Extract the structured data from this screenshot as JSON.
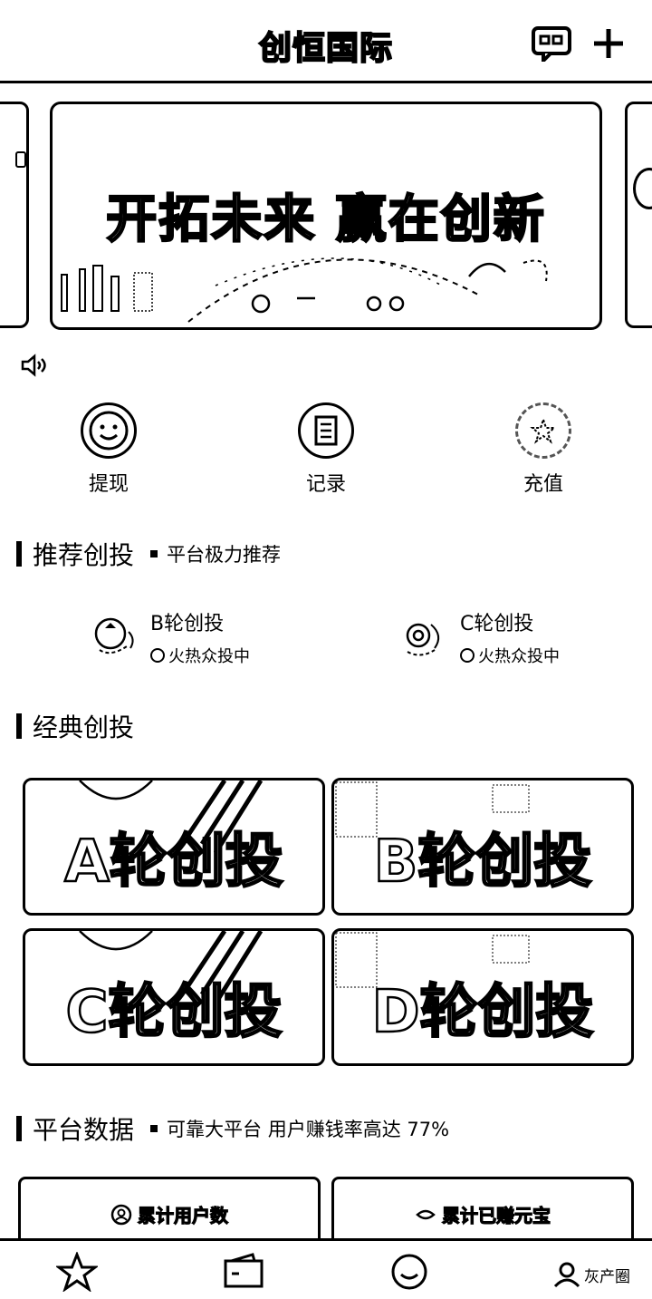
{
  "header": {
    "title": "创恒国际"
  },
  "banner": {
    "headline": "开拓未来 赢在创新"
  },
  "quick_actions": [
    {
      "label": "提现",
      "icon": "smiley-icon"
    },
    {
      "label": "记录",
      "icon": "document-icon"
    },
    {
      "label": "充值",
      "icon": "star-icon"
    }
  ],
  "recommended": {
    "title": "推荐创投",
    "subtitle": "平台极力推荐",
    "items": [
      {
        "title": "B轮创投",
        "status": "火热众投中"
      },
      {
        "title": "C轮创投",
        "status": "火热众投中"
      }
    ]
  },
  "classic": {
    "title": "经典创投",
    "cards": [
      "A轮创投",
      "B轮创投",
      "C轮创投",
      "D轮创投"
    ]
  },
  "platform": {
    "title": "平台数据",
    "subtitle": "可靠大平台 用户赚钱率高达 77%",
    "stats": [
      {
        "label": "累计用户数",
        "icon": "user-icon"
      },
      {
        "label": "累计已赚元宝",
        "icon": "coin-icon"
      }
    ]
  },
  "nav": {
    "watermark": "灰产圈"
  }
}
